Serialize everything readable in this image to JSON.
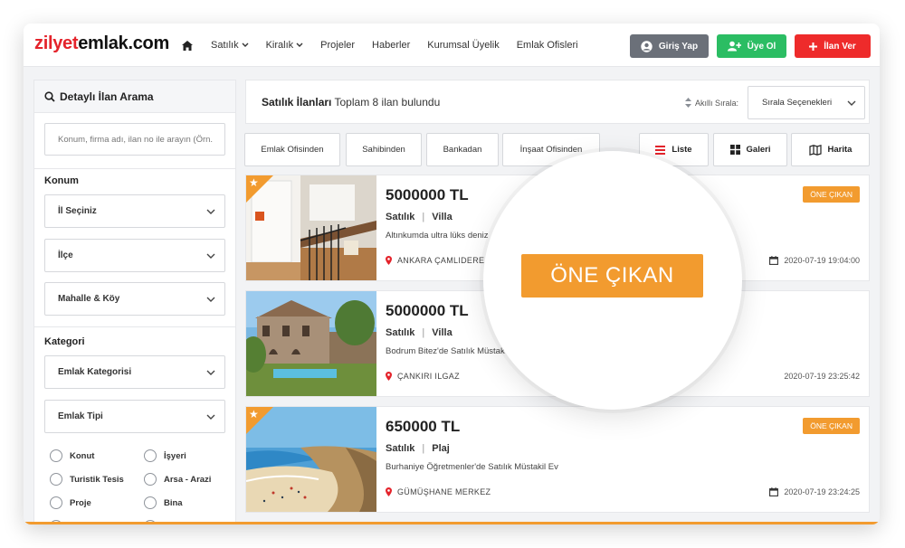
{
  "header": {
    "logo_part1": "zilyet",
    "logo_part2": "emlak.com",
    "nav": [
      {
        "label": "Satılık",
        "dropdown": true
      },
      {
        "label": "Kiralık",
        "dropdown": true
      },
      {
        "label": "Projeler"
      },
      {
        "label": "Haberler"
      },
      {
        "label": "Kurumsal Üyelik"
      },
      {
        "label": "Emlak Ofisleri"
      }
    ],
    "login_label": "Giriş Yap",
    "register_label": "Üye Ol",
    "post_label": "İlan Ver"
  },
  "sidebar": {
    "title": "Detaylı İlan Arama",
    "search_placeholder": "Konum, firma adı, ilan no ile arayın (Örn.",
    "location_label": "Konum",
    "province": "İl Seçiniz",
    "district": "İlçe",
    "neighborhood": "Mahalle & Köy",
    "category_label": "Kategori",
    "realty_category": "Emlak Kategorisi",
    "realty_type": "Emlak Tipi",
    "types": [
      "Konut",
      "İşyeri",
      "Turistik Tesis",
      "Arsa - Arazi",
      "Proje",
      "Bina"
    ]
  },
  "results": {
    "title_bold": "Satılık İlanları",
    "title_rest": "Toplam 8 ilan bulundu",
    "sort_label": "Akıllı Sırala:",
    "sort_value": "Sırala Seçenekleri",
    "filters": [
      "Emlak Ofisinden",
      "Sahibinden",
      "Bankadan",
      "İnşaat Ofisinden"
    ],
    "views": [
      "Liste",
      "Galeri",
      "Harita"
    ]
  },
  "listings": [
    {
      "price": "5000000 TL",
      "status": "Satılık",
      "type": "Villa",
      "description": "Altınkumda ultra lüks deniz",
      "location": "ANKARA ÇAMLIDERE",
      "date": "2020-07-19 19:04:00",
      "featured": true,
      "badge": "ÖNE ÇIKAN"
    },
    {
      "price": "5000000 TL",
      "status": "Satılık",
      "type": "Villa",
      "description": "Bodrum Bitez'de Satılık Müstak",
      "location": "ÇANKIRI ILGAZ",
      "date": "2020-07-19 23:25:42",
      "featured": false,
      "badge": ""
    },
    {
      "price": "650000 TL",
      "status": "Satılık",
      "type": "Plaj",
      "description": "Burhaniye Öğretmenler'de Satılık Müstakil Ev",
      "location": "GÜMÜŞHANE MERKEZ",
      "date": "2020-07-19 23:24:25",
      "featured": true,
      "badge": "ÖNE ÇIKAN"
    }
  ],
  "magnifier": {
    "badge": "ÖNE ÇIKAN"
  },
  "colors": {
    "accent": "#f29b2f",
    "login": "#6b7079",
    "register": "#2bbd63",
    "post": "#ee2b2b",
    "logo_red": "#e4232b"
  },
  "icons": [
    "home-icon",
    "chevron-down-icon",
    "user-icon",
    "user-plus-icon",
    "plus-icon",
    "search-icon",
    "sort-icon",
    "list-icon",
    "grid-icon",
    "map-icon",
    "map-pin-icon",
    "calendar-icon",
    "star-icon"
  ]
}
